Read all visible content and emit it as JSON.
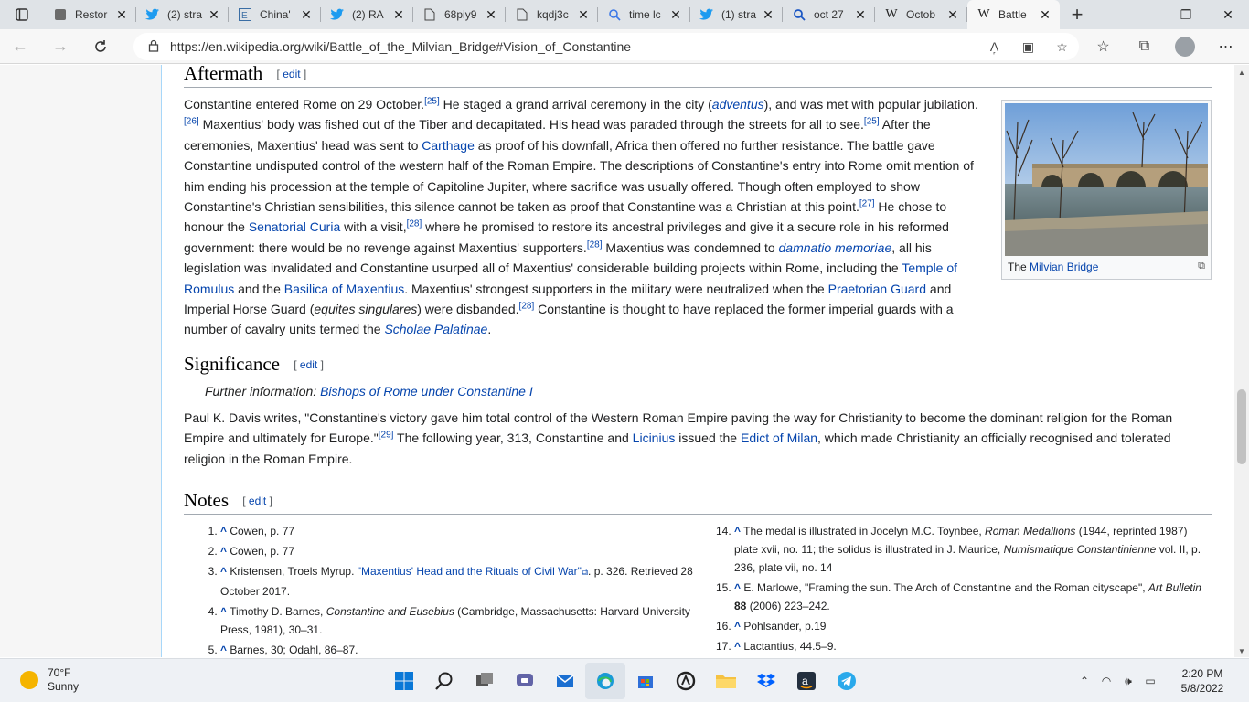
{
  "browser": {
    "tabs": [
      {
        "title": "Restor",
        "icon": "page-icon"
      },
      {
        "title": "(2) stra",
        "icon": "twitter-icon"
      },
      {
        "title": "China'",
        "icon": "ie-icon"
      },
      {
        "title": "(2) RA",
        "icon": "twitter-icon"
      },
      {
        "title": "68piy9",
        "icon": "document-icon"
      },
      {
        "title": "kqdj3c",
        "icon": "document-icon"
      },
      {
        "title": "time lc",
        "icon": "search-icon"
      },
      {
        "title": "(1) stra",
        "icon": "twitter-icon"
      },
      {
        "title": "oct 27",
        "icon": "search-icon"
      },
      {
        "title": "Octob",
        "icon": "wikipedia-icon"
      },
      {
        "title": "Battle",
        "icon": "wikipedia-icon",
        "active": true
      }
    ],
    "url": "https://en.wikipedia.org/wiki/Battle_of_the_Milvian_Bridge#Vision_of_Constantine"
  },
  "article": {
    "aftermath": {
      "heading": "Aftermath",
      "edit": "edit",
      "image_caption_prefix": "The ",
      "image_caption_link": "Milvian Bridge",
      "t1": "Constantine entered Rome on 29 October.",
      "r1": "[25]",
      "t2": " He staged a grand arrival ceremony in the city (",
      "l1": "adventus",
      "t3": "), and was met with popular jubilation.",
      "r2": "[26]",
      "t4": " Maxentius' body was fished out of the Tiber and decapitated. His head was paraded through the streets for all to see.",
      "r3": "[25]",
      "t5": " After the ceremonies, Maxentius' head was sent to ",
      "l2": "Carthage",
      "t6": " as proof of his downfall, Africa then offered no further resistance. The battle gave Constantine undisputed control of the western half of the Roman Empire. The descriptions of Constantine's entry into Rome omit mention of him ending his procession at the temple of Capitoline Jupiter, where sacrifice was usually offered. Though often employed to show Constantine's Christian sensibilities, this silence cannot be taken as proof that Constantine was a Christian at this point.",
      "r4": "[27]",
      "t7": " He chose to honour the ",
      "l3": "Senatorial Curia",
      "t8": " with a visit,",
      "r5": "[28]",
      "t9": " where he promised to restore its ancestral privileges and give it a secure role in his reformed government: there would be no revenge against Maxentius' supporters.",
      "r6": "[28]",
      "t10": " Maxentius was condemned to ",
      "l4": "damnatio memoriae",
      "t11": ", all his legislation was invalidated and Constantine usurped all of Maxentius' considerable building projects within Rome, including the ",
      "l5": "Temple of Romulus",
      "t12": " and the ",
      "l6": "Basilica of Maxentius",
      "t13": ". Maxentius' strongest supporters in the military were neutralized when the ",
      "l7": "Praetorian Guard",
      "t14": " and Imperial Horse Guard (",
      "i1": "equites singulares",
      "t15": ") were disbanded.",
      "r7": "[28]",
      "t16": " Constantine is thought to have replaced the former imperial guards with a number of cavalry units termed the ",
      "l8": "Scholae Palatinae",
      "t17": "."
    },
    "significance": {
      "heading": "Significance",
      "edit": "edit",
      "further_label": "Further information: ",
      "further_link": "Bishops of Rome under Constantine I",
      "t1": "Paul K. Davis writes, \"Constantine's victory gave him total control of the Western Roman Empire paving the way for Christianity to become the dominant religion for the Roman Empire and ultimately for Europe.\"",
      "r1": "[29]",
      "t2": " The following year, 313, Constantine and ",
      "l1": "Licinius",
      "t3": " issued the ",
      "l2": "Edict of Milan",
      "t4": ", which made Christianity an officially recognised and tolerated religion in the Roman Empire."
    },
    "notes": {
      "heading": "Notes",
      "edit": "edit",
      "caret": "^",
      "left": {
        "n1": "Cowen, p. 77",
        "n2": "Cowen, p. 77",
        "n3a": "Kristensen, Troels Myrup. ",
        "n3link": "\"Maxentius' Head and the Rituals of Civil War\"",
        "n3b": ". p. 326. Retrieved 28 October 2017.",
        "n4a": "Timothy D. Barnes, ",
        "n4i": "Constantine and Eusebius",
        "n4b": " (Cambridge, Massachusetts: Harvard University Press, 1981), 30–31.",
        "n5": "Barnes, 30; Odahl, 86–87."
      },
      "right": {
        "n14a": "The medal is illustrated in Jocelyn M.C. Toynbee, ",
        "n14i": "Roman Medallions",
        "n14b": " (1944, reprinted 1987) plate xvii, no. 11; the solidus is illustrated in J. Maurice, ",
        "n14i2": "Numismatique Constantinienne",
        "n14c": " vol. II, p. 236, plate vii, no. 14",
        "n15a": "E. Marlowe, \"Framing the sun. The Arch of Constantine and the Roman cityscape\", ",
        "n15i": "Art Bulletin",
        "n15b": " ",
        "n15bold": "88",
        "n15c": " (2006) 223–242.",
        "n16": "Pohlsander, p.19",
        "n17": "Lactantius, 44.5–9."
      }
    }
  },
  "taskbar": {
    "temp": "70°F",
    "condition": "Sunny",
    "time": "2:20 PM",
    "date": "5/8/2022"
  }
}
